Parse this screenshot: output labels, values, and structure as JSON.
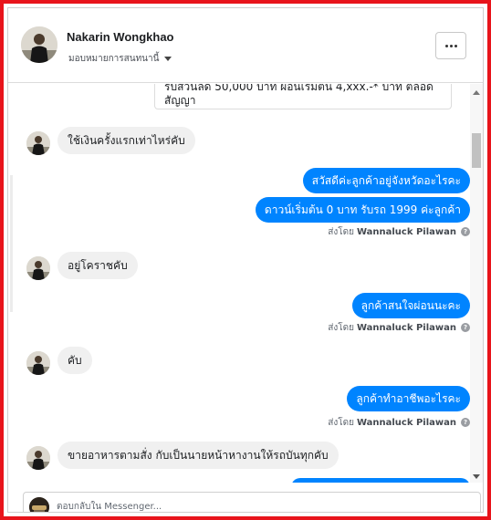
{
  "header": {
    "name": "Nakarin Wongkhao",
    "assign_label": "มอบหมายการสนทนานี้"
  },
  "chat": {
    "top_snippet": "รับส่วนลด 50,000 บาท ผ่อนเริ่มต้น 4,xxx.-* บาท ตลอดสัญญา",
    "messages": [
      {
        "dir": "in",
        "text": "ใช้เงินครั้งแรกเท่าไหร่คับ"
      },
      {
        "dir": "out",
        "text": "สวัสดีค่ะลูกค้าอยู่จังหวัดอะไรคะ"
      },
      {
        "dir": "out",
        "text": "ดาวน์เริ่มต้น 0 บาท รับรถ 1999 ค่ะลูกค้า"
      },
      {
        "dir": "in",
        "text": "อยู่โคราชคับ"
      },
      {
        "dir": "out",
        "text": "ลูกค้าสนใจผ่อนนะคะ"
      },
      {
        "dir": "in",
        "text": "คับ"
      },
      {
        "dir": "out",
        "text": "ลูกค้าทำอาชีพอะไรคะ"
      },
      {
        "dir": "in",
        "text": "ขายอาหารตามสั่ง กับเป็นนายหน้าหางานให้รถบันทุกคับ"
      }
    ],
    "sent_by_prefix": "ส่งโดย",
    "sent_by_name": "Wannaluck Pilawan",
    "help_glyph": "?"
  },
  "composer": {
    "placeholder": "ตอบกลับใน Messenger..."
  },
  "colors": {
    "frame": "#e8141b",
    "outgoing": "#0084ff",
    "incoming": "#f0f0f0"
  }
}
